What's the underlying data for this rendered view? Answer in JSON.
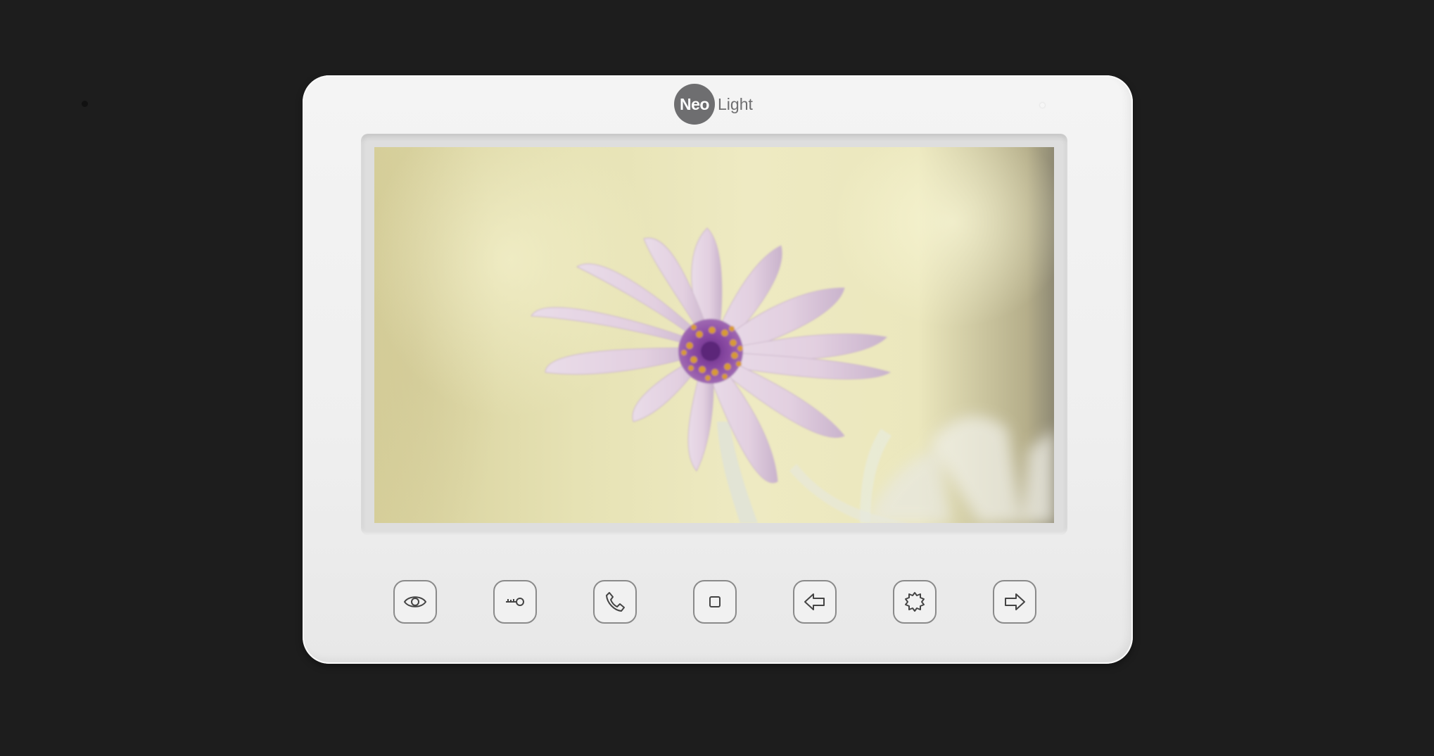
{
  "device": {
    "brand": {
      "logo_part1": "Neo",
      "logo_part2": "Light"
    },
    "screen_image": "daisy-flower-photo",
    "buttons": [
      {
        "icon": "eye-icon"
      },
      {
        "icon": "key-icon"
      },
      {
        "icon": "phone-icon"
      },
      {
        "icon": "stop-square-icon"
      },
      {
        "icon": "arrow-left-icon"
      },
      {
        "icon": "gear-icon"
      },
      {
        "icon": "arrow-right-icon"
      }
    ]
  }
}
